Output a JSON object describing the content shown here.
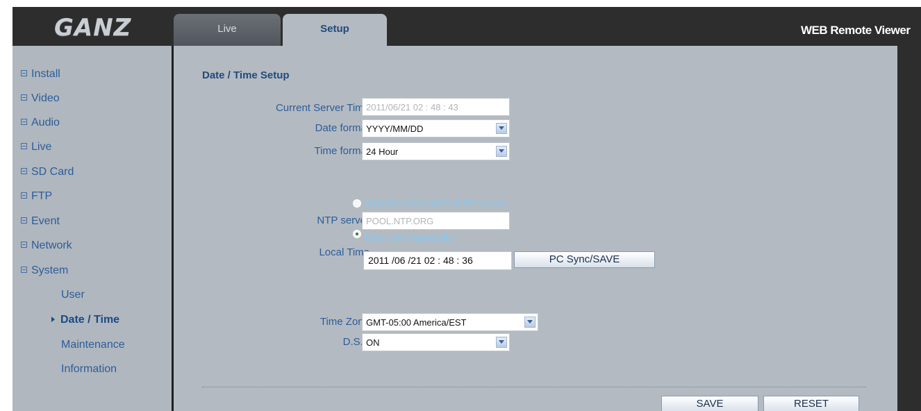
{
  "header": {
    "logo_text": "GANZ",
    "app_title": "WEB Remote Viewer",
    "tabs": [
      {
        "label": "Live",
        "active": false
      },
      {
        "label": "Setup",
        "active": true
      }
    ]
  },
  "sidebar": {
    "items": [
      {
        "label": "Install",
        "icon": "plus-box-icon"
      },
      {
        "label": "Video",
        "icon": "plus-box-icon"
      },
      {
        "label": "Audio",
        "icon": "plus-box-icon"
      },
      {
        "label": "Live",
        "icon": "plus-box-icon"
      },
      {
        "label": "SD Card",
        "icon": "plus-box-icon"
      },
      {
        "label": "FTP",
        "icon": "plus-box-icon"
      },
      {
        "label": "Event",
        "icon": "plus-box-icon"
      },
      {
        "label": "Network",
        "icon": "plus-box-icon"
      },
      {
        "label": "System",
        "icon": "minus-box-icon"
      }
    ],
    "subitems": [
      {
        "label": "User",
        "active": false
      },
      {
        "label": "Date / Time",
        "active": true
      },
      {
        "label": "Maintenance",
        "active": false
      },
      {
        "label": "Information",
        "active": false
      }
    ]
  },
  "main": {
    "title": "Date / Time Setup",
    "current_server_time": {
      "label": "Current Server Time",
      "value": "2011/06/21   02 : 48 : 43"
    },
    "date_format": {
      "label": "Date format",
      "value": "YYYY/MM/DD"
    },
    "time_format": {
      "label": "Time format",
      "value": "24 Hour"
    },
    "ntp_option": {
      "label": "Synchronize with NTP server",
      "checked": false
    },
    "ntp_server": {
      "label": "NTP server",
      "value": "POOL.NTP.ORG"
    },
    "manual_option": {
      "label": "User set manually",
      "checked": true
    },
    "local_time": {
      "label": "Local Time",
      "value": "2011  /06  /21   02 : 48  : 36"
    },
    "pc_sync_button": "PC Sync/SAVE",
    "time_zone": {
      "label": "Time Zone",
      "value": "GMT-05:00 America/EST"
    },
    "dst": {
      "label": "D.S.T",
      "value": "ON"
    },
    "save_button": "SAVE",
    "reset_button": "RESET"
  },
  "colors": {
    "frame": "#2d2d2d",
    "panel": "#b4bac1",
    "link": "#2a5d9b",
    "title": "#1f4a7d",
    "radio_label": "#8fc6ea"
  }
}
